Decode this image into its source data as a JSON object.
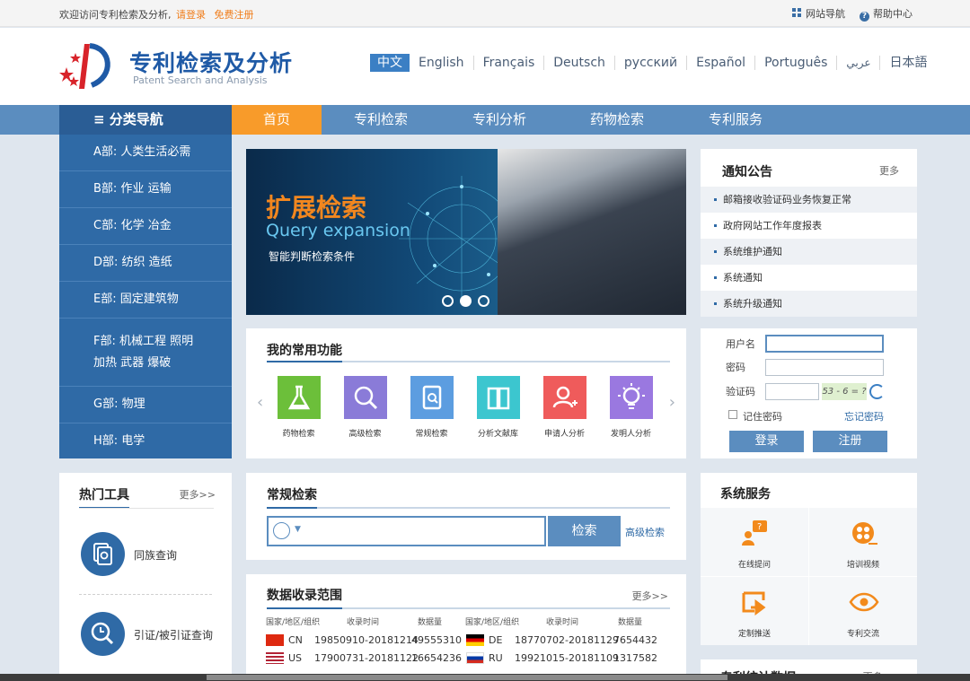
{
  "topbar": {
    "welcome": "欢迎访问专利检索及分析,",
    "login_link": "请登录",
    "register_link": "免费注册",
    "site_nav": "网站导航",
    "help": "帮助中心"
  },
  "header": {
    "title": "专利检索及分析",
    "subtitle": "Patent Search and Analysis",
    "languages": [
      "中文",
      "English",
      "Français",
      "Deutsch",
      "русский",
      "Español",
      "Português",
      "عربي",
      "日本語"
    ]
  },
  "nav": {
    "category": "≡ 分类导航",
    "items": [
      "首页",
      "专利检索",
      "专利分析",
      "药物检索",
      "专利服务"
    ]
  },
  "sidebar": {
    "items": [
      "A部: 人类生活必需",
      "B部: 作业 运输",
      "C部: 化学 冶金",
      "D部: 纺织 造纸",
      "E部: 固定建筑物",
      "F部: 机械工程 照明 加热 武器 爆破",
      "G部: 物理",
      "H部: 电学"
    ]
  },
  "banner": {
    "title": "扩展检索",
    "subtitle": "Query expansion",
    "desc": "智能判断检索条件"
  },
  "notices": {
    "title": "通知公告",
    "more": "更多",
    "items": [
      "邮箱接收验证码业务恢复正常",
      "政府网站工作年度报表",
      "系统维护通知",
      "系统通知",
      "系统升级通知"
    ]
  },
  "login": {
    "username_label": "用户名",
    "password_label": "密码",
    "captcha_label": "验证码",
    "captcha_text": "53 - 6 = ?",
    "remember": "记住密码",
    "forgot": "忘记密码",
    "login_btn": "登录",
    "register_btn": "注册"
  },
  "functions": {
    "title": "我的常用功能",
    "items": [
      {
        "label": "药物检索",
        "color": "#6cbf3a",
        "icon": "flask-icon"
      },
      {
        "label": "高级检索",
        "color": "#8a7bd8",
        "icon": "search-icon"
      },
      {
        "label": "常规检索",
        "color": "#5c9de0",
        "icon": "doc-search-icon"
      },
      {
        "label": "分析文献库",
        "color": "#3cc6cf",
        "icon": "book-icon"
      },
      {
        "label": "申请人分析",
        "color": "#ef5b5b",
        "icon": "user-add-icon"
      },
      {
        "label": "发明人分析",
        "color": "#9a78e0",
        "icon": "bulb-icon"
      }
    ]
  },
  "hot_tools": {
    "title": "热门工具",
    "more": "更多>>",
    "items": [
      "同族查询",
      "引证/被引证查询"
    ]
  },
  "search": {
    "title": "常规检索",
    "button": "检索",
    "advanced": "高级检索"
  },
  "data_range": {
    "title": "数据收录范围",
    "more": "更多>>",
    "headers": [
      "国家/地区/组织",
      "收录时间",
      "数据量",
      "国家/地区/组织",
      "收录时间",
      "数据量"
    ],
    "rows": [
      [
        "CN",
        "19850910-20181214",
        "49555310",
        "DE",
        "18770702-20181129",
        "7654432"
      ],
      [
        "US",
        "17900731-20181122",
        "16654236",
        "RU",
        "19921015-20181109",
        "1317582"
      ]
    ]
  },
  "services": {
    "title": "系统服务",
    "items": [
      "在线提问",
      "培训视频",
      "定制推送",
      "专利交流"
    ]
  },
  "stats": {
    "title": "专利统计数据",
    "more": "更多>>"
  }
}
